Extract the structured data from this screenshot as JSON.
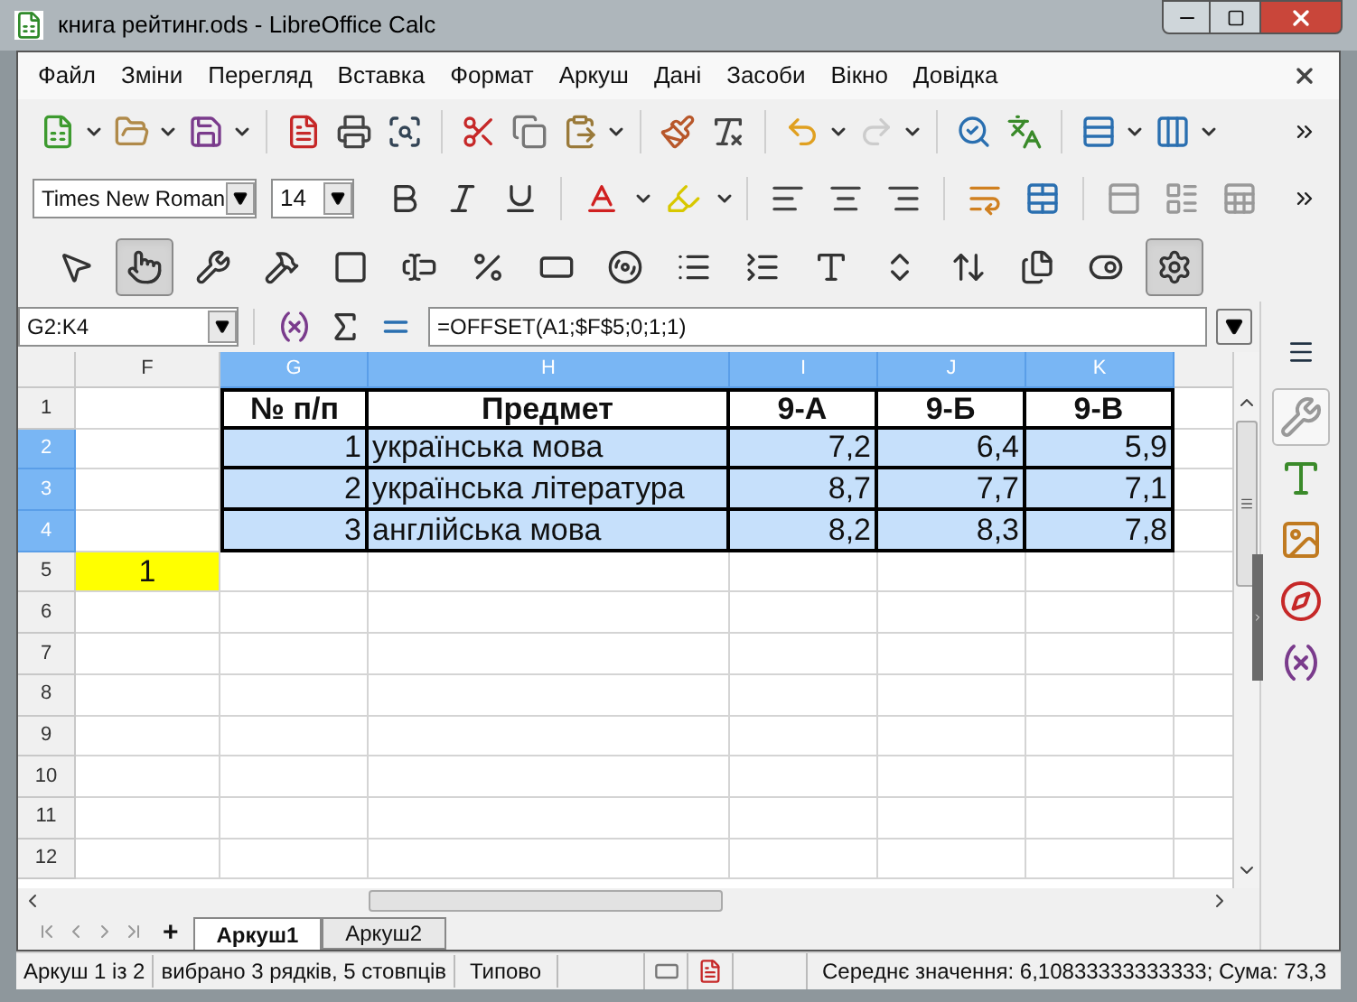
{
  "window": {
    "title": "книга рейтинг.ods - LibreOffice Calc"
  },
  "menu": [
    "Файл",
    "Зміни",
    "Перегляд",
    "Вставка",
    "Формат",
    "Аркуш",
    "Дані",
    "Засоби",
    "Вікно",
    "Довідка"
  ],
  "standard_toolbar": [
    {
      "kind": "new",
      "dropdown": true,
      "disabled": false
    },
    {
      "kind": "open",
      "dropdown": true,
      "disabled": false
    },
    {
      "kind": "save",
      "dropdown": true,
      "disabled": false
    },
    {
      "kind": "sep"
    },
    {
      "kind": "pdf",
      "dropdown": false,
      "disabled": false
    },
    {
      "kind": "print",
      "dropdown": false,
      "disabled": false
    },
    {
      "kind": "preview",
      "dropdown": false,
      "disabled": false
    },
    {
      "kind": "sep"
    },
    {
      "kind": "cut",
      "dropdown": false,
      "disabled": false
    },
    {
      "kind": "copy",
      "dropdown": false,
      "disabled": false
    },
    {
      "kind": "paste",
      "dropdown": true,
      "disabled": false
    },
    {
      "kind": "sep"
    },
    {
      "kind": "clone",
      "dropdown": false,
      "disabled": false
    },
    {
      "kind": "clear",
      "dropdown": false,
      "disabled": false
    },
    {
      "kind": "sep"
    },
    {
      "kind": "undo",
      "dropdown": true,
      "disabled": false
    },
    {
      "kind": "redo",
      "dropdown": true,
      "disabled": true
    },
    {
      "kind": "sep"
    },
    {
      "kind": "find",
      "dropdown": false,
      "disabled": false
    },
    {
      "kind": "spell",
      "dropdown": false,
      "disabled": false
    },
    {
      "kind": "sep"
    },
    {
      "kind": "rows",
      "dropdown": true,
      "disabled": false
    },
    {
      "kind": "columns",
      "dropdown": true,
      "disabled": false
    }
  ],
  "formatting": {
    "font": "Times New Roman",
    "size": "14"
  },
  "form_controls": [
    {
      "kind": "select",
      "pressed": false
    },
    {
      "kind": "push-button",
      "pressed": true
    },
    {
      "kind": "control-properties",
      "pressed": false
    },
    {
      "kind": "form-properties",
      "pressed": false
    },
    {
      "kind": "checkbox",
      "pressed": false
    },
    {
      "kind": "text-box",
      "pressed": false
    },
    {
      "kind": "formatted-field",
      "pressed": false
    },
    {
      "kind": "button",
      "pressed": false
    },
    {
      "kind": "radio",
      "pressed": false
    },
    {
      "kind": "list-box",
      "pressed": false
    },
    {
      "kind": "combo-box",
      "pressed": false
    },
    {
      "kind": "label",
      "pressed": false
    },
    {
      "kind": "spin",
      "pressed": false
    },
    {
      "kind": "scrollbar",
      "pressed": false
    },
    {
      "kind": "group",
      "pressed": false
    },
    {
      "kind": "toggle",
      "pressed": false
    },
    {
      "kind": "design-mode",
      "pressed": true
    }
  ],
  "formula_bar": {
    "name_box": "G2:K4",
    "formula": "=OFFSET(A1;$F$5;0;1;1)"
  },
  "sheet": {
    "columns": [
      {
        "label": "F",
        "selected": false
      },
      {
        "label": "G",
        "selected": true
      },
      {
        "label": "H",
        "selected": true
      },
      {
        "label": "I",
        "selected": true
      },
      {
        "label": "J",
        "selected": true
      },
      {
        "label": "K",
        "selected": true
      }
    ],
    "rows": [
      {
        "label": "1",
        "selected": false,
        "cells": [
          {
            "kind": "empty"
          },
          {
            "kind": "heading",
            "text": "№ п/п"
          },
          {
            "kind": "heading",
            "text": "Предмет"
          },
          {
            "kind": "heading",
            "text": "9-А"
          },
          {
            "kind": "heading",
            "text": "9-Б"
          },
          {
            "kind": "heading",
            "text": "9-В"
          }
        ]
      },
      {
        "label": "2",
        "selected": true,
        "cells": [
          {
            "kind": "empty"
          },
          {
            "kind": "number",
            "text": "1"
          },
          {
            "kind": "text",
            "text": "українська мова"
          },
          {
            "kind": "number",
            "text": "7,2"
          },
          {
            "kind": "number",
            "text": "6,4"
          },
          {
            "kind": "number",
            "text": "5,9"
          }
        ]
      },
      {
        "label": "3",
        "selected": true,
        "cells": [
          {
            "kind": "empty"
          },
          {
            "kind": "number",
            "text": "2"
          },
          {
            "kind": "text",
            "text": "українська література"
          },
          {
            "kind": "number",
            "text": "8,7"
          },
          {
            "kind": "number",
            "text": "7,7"
          },
          {
            "kind": "number",
            "text": "7,1"
          }
        ]
      },
      {
        "label": "4",
        "selected": true,
        "cells": [
          {
            "kind": "empty"
          },
          {
            "kind": "number",
            "text": "3"
          },
          {
            "kind": "text",
            "text": "англійська мова"
          },
          {
            "kind": "number",
            "text": "8,2"
          },
          {
            "kind": "number",
            "text": "8,3"
          },
          {
            "kind": "number",
            "text": "7,8"
          }
        ]
      },
      {
        "label": "5",
        "selected": false,
        "cells": [
          {
            "kind": "highlighted",
            "text": "1"
          }
        ]
      },
      {
        "label": "6",
        "selected": false
      },
      {
        "label": "7",
        "selected": false
      },
      {
        "label": "8",
        "selected": false
      },
      {
        "label": "9",
        "selected": false
      },
      {
        "label": "10",
        "selected": false
      },
      {
        "label": "11",
        "selected": false
      },
      {
        "label": "12",
        "selected": false
      }
    ]
  },
  "sheet_tabs": {
    "add": "+",
    "tabs": [
      {
        "label": "Аркуш1",
        "selected": true
      },
      {
        "label": "Аркуш2",
        "selected": false
      }
    ]
  },
  "sidebar": [
    {
      "kind": "properties",
      "selected": true
    },
    {
      "kind": "styles",
      "selected": false
    },
    {
      "kind": "gallery",
      "selected": false
    },
    {
      "kind": "navigator",
      "selected": false
    },
    {
      "kind": "functions",
      "selected": false
    }
  ],
  "status_bar": {
    "sheet": "Аркуш 1 із 2",
    "selection": "вибрано 3 рядків, 5 стовпців",
    "page_style": "Типово",
    "summary": "Середнє значення: 6,10833333333333; Сума: 73,3"
  }
}
